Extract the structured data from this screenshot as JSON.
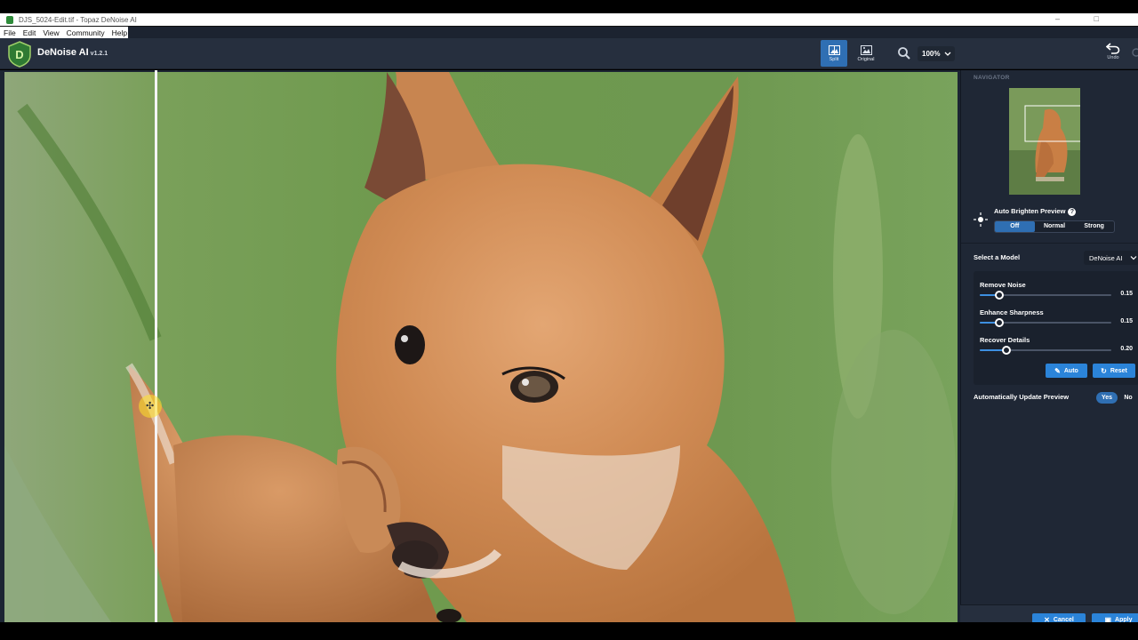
{
  "window": {
    "title": "DJS_5024-Edit.tif - Topaz DeNoise AI",
    "controls": "–  □"
  },
  "menu": [
    "File",
    "Edit",
    "View",
    "Community",
    "Help"
  ],
  "header": {
    "app_name": "DeNoise AI",
    "version": "v1.2.1",
    "logo_letter": "D",
    "view_modes": {
      "split": "Split",
      "original": "Original"
    },
    "active_view": "Split",
    "zoom": "100%",
    "undo_label": "Undo"
  },
  "panel": {
    "navigator_title": "NAVIGATOR",
    "auto_brighten": {
      "label": "Auto Brighten Preview",
      "help": "?",
      "options": [
        "Off",
        "Normal",
        "Strong"
      ],
      "selected": "Off"
    },
    "model": {
      "label": "Select a Model",
      "selected": "DeNoise AI"
    },
    "sliders": [
      {
        "label": "Remove Noise",
        "value": "0.15",
        "fraction": 0.15
      },
      {
        "label": "Enhance Sharpness",
        "value": "0.15",
        "fraction": 0.15
      },
      {
        "label": "Recover Details",
        "value": "0.20",
        "fraction": 0.2
      }
    ],
    "buttons": {
      "auto": "Auto",
      "reset": "Reset"
    },
    "auto_update": {
      "label": "Automatically Update Preview",
      "options": [
        "Yes",
        "No"
      ],
      "selected": "Yes"
    },
    "footer": {
      "cancel": "Cancel",
      "apply": "Apply"
    }
  },
  "colors": {
    "accent": "#2b84d9",
    "panel_bg": "#1f2735",
    "header_bg": "#262f3e"
  }
}
